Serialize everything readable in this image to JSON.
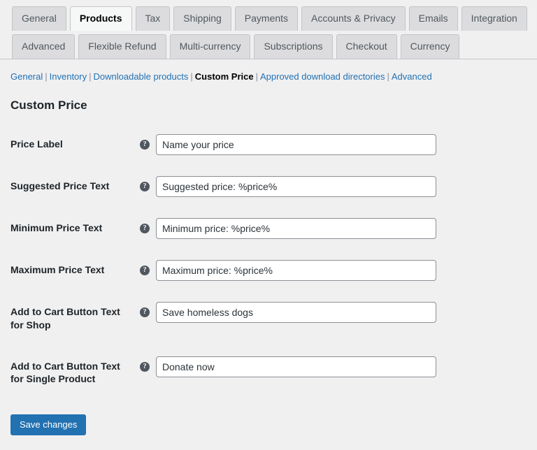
{
  "tabs": {
    "row1": [
      {
        "label": "General",
        "active": false
      },
      {
        "label": "Products",
        "active": true
      },
      {
        "label": "Tax",
        "active": false
      },
      {
        "label": "Shipping",
        "active": false
      },
      {
        "label": "Payments",
        "active": false
      },
      {
        "label": "Accounts & Privacy",
        "active": false
      },
      {
        "label": "Emails",
        "active": false
      },
      {
        "label": "Integration",
        "active": false
      }
    ],
    "row2": [
      {
        "label": "Advanced",
        "active": false
      },
      {
        "label": "Flexible Refund",
        "active": false
      },
      {
        "label": "Multi-currency",
        "active": false
      },
      {
        "label": "Subscriptions",
        "active": false
      },
      {
        "label": "Checkout",
        "active": false
      },
      {
        "label": "Currency",
        "active": false
      }
    ]
  },
  "subnav": {
    "separator": "|",
    "items": [
      {
        "label": "General",
        "current": false
      },
      {
        "label": "Inventory",
        "current": false
      },
      {
        "label": "Downloadable products",
        "current": false
      },
      {
        "label": "Custom Price",
        "current": true
      },
      {
        "label": "Approved download directories",
        "current": false
      },
      {
        "label": "Advanced",
        "current": false
      }
    ]
  },
  "page": {
    "title": "Custom Price"
  },
  "help_icon_glyph": "?",
  "fields": [
    {
      "label": "Price Label",
      "help_icon": "help-icon",
      "value": "Name your price",
      "placeholder": "Name your price"
    },
    {
      "label": "Suggested Price Text",
      "help_icon": "help-icon",
      "value": "Suggested price: %price%",
      "placeholder": "Suggested price: %price%"
    },
    {
      "label": "Minimum Price Text",
      "help_icon": "help-icon",
      "value": "Minimum price: %price%",
      "placeholder": "Minimum price: %price%"
    },
    {
      "label": "Maximum Price Text",
      "help_icon": "help-icon",
      "value": "Maximum price: %price%",
      "placeholder": "Maximum price: %price%"
    },
    {
      "label": "Add to Cart Button Text for Shop",
      "help_icon": "help-icon",
      "value": "Save homeless dogs",
      "placeholder": "Save homeless dogs"
    },
    {
      "label": "Add to Cart Button Text for Single Product",
      "help_icon": "help-icon",
      "value": "Donate now",
      "placeholder": "Donate now"
    }
  ],
  "submit": {
    "save_label": "Save changes"
  },
  "colors": {
    "page_background": "#f0f0f1",
    "tab_inactive": "#dcdcde",
    "tab_active": "#f6f7f7",
    "link": "#2271b1",
    "primary_button": "#2271b1",
    "label_text": "#1d2327",
    "input_border": "#8c8f94"
  }
}
